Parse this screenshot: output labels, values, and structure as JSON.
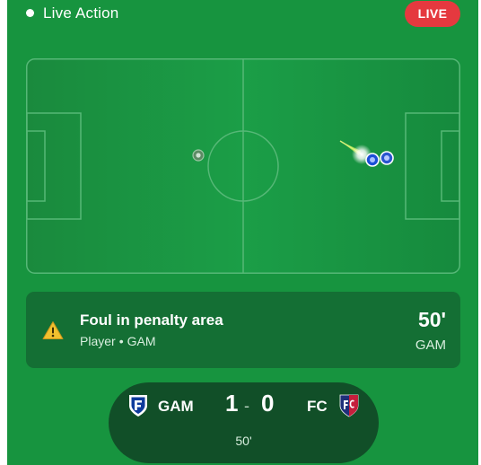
{
  "header": {
    "title": "Live Action",
    "live_label": "LIVE"
  },
  "colors": {
    "pitch": "#17943f",
    "card": "#146f34",
    "scoreboard": "#114f28",
    "live_badge": "#e5393f",
    "warning": "#f2c12e"
  },
  "event": {
    "title": "Foul in penalty area",
    "player": "Player",
    "team": "GAM",
    "minute": "50'",
    "team_label": "GAM",
    "icon": "warning-icon"
  },
  "scoreboard": {
    "home": {
      "abbr": "GAM",
      "score": "1",
      "crest": "home-crest-icon"
    },
    "away": {
      "abbr": "FC",
      "score": "0",
      "crest": "away-crest-icon"
    },
    "separator": "-",
    "minute": "50'"
  }
}
